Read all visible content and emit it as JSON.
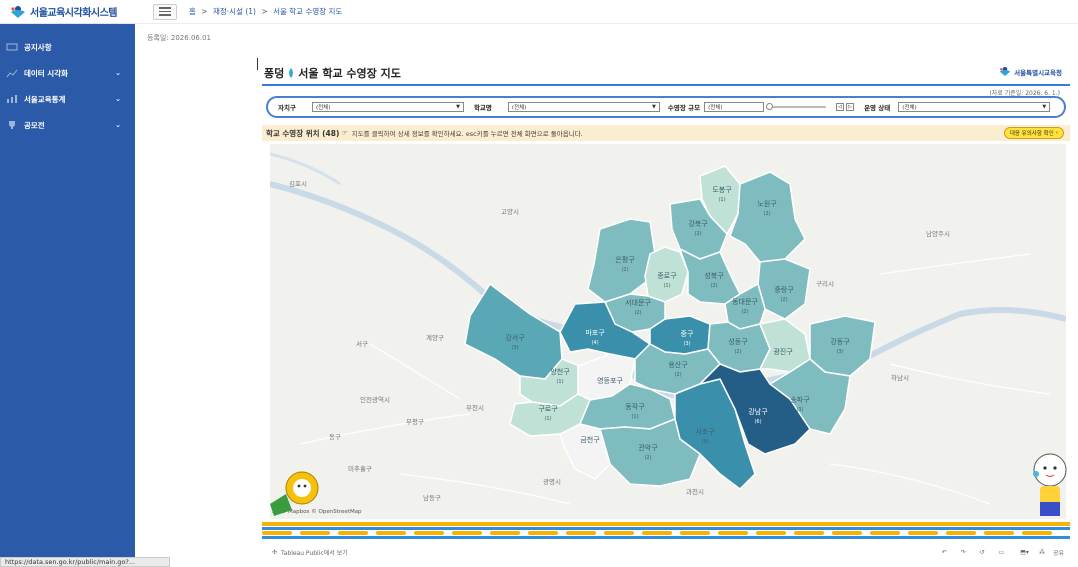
{
  "app": {
    "logo_text": "서울교육시각화시스템"
  },
  "sidebar": {
    "items": [
      {
        "label": "공지사항",
        "icon": "megaphone-icon",
        "has_chevron": false
      },
      {
        "label": "데이터 시각화",
        "icon": "chart-icon",
        "has_chevron": true
      },
      {
        "label": "서울교육통계",
        "icon": "stats-icon",
        "has_chevron": true
      },
      {
        "label": "공모전",
        "icon": "trophy-icon",
        "has_chevron": true
      }
    ],
    "chevron": "⌄"
  },
  "topbar": {
    "breadcrumb": [
      "홈",
      "재정·시설 (1)",
      "서울 학교 수영장 지도"
    ],
    "separator": ">"
  },
  "reg_date": "등록일: 2026.06.01",
  "panel": {
    "title_pre": "퐁덩",
    "title_main": "서울 학교 수영장 지도",
    "edu_logo": "서울특별시교육청",
    "ref_date": "(자료 기준일: 2026. 6. 1.)",
    "filters": {
      "district_label": "자치구",
      "district_value": "(전체)",
      "school_label": "학교명",
      "school_value": "(전체)",
      "size_label": "수영장 규모",
      "size_value": "(전체)",
      "status_label": "운영 상태",
      "status_value": "(전체)"
    },
    "info": {
      "text": "학교 수영장 위치 (48)",
      "hint": "지도를 클릭하여 상세 정보를 확인하세요. esc키를 누르면 전체 화면으로 돌아옵니다.",
      "button": "대응 유의사항 확인"
    },
    "map_labels": {
      "districts": [
        {
          "name": "도봉구",
          "count": "(1)"
        },
        {
          "name": "노원구",
          "count": "(2)"
        },
        {
          "name": "강북구",
          "count": "(2)"
        },
        {
          "name": "은평구",
          "count": "(2)"
        },
        {
          "name": "종로구",
          "count": "(1)"
        },
        {
          "name": "성북구",
          "count": "(2)"
        },
        {
          "name": "중랑구",
          "count": "(2)"
        },
        {
          "name": "서대문구",
          "count": "(2)"
        },
        {
          "name": "동대문구",
          "count": "(2)"
        },
        {
          "name": "강서구",
          "count": "(3)"
        },
        {
          "name": "마포구",
          "count": "(4)"
        },
        {
          "name": "중구",
          "count": "(3)"
        },
        {
          "name": "성동구",
          "count": "(2)"
        },
        {
          "name": "광진구",
          "count": ""
        },
        {
          "name": "강동구",
          "count": "(3)"
        },
        {
          "name": "양천구",
          "count": "(1)"
        },
        {
          "name": "영등포구",
          "count": ""
        },
        {
          "name": "용산구",
          "count": "(2)"
        },
        {
          "name": "구로구",
          "count": "(1)"
        },
        {
          "name": "동작구",
          "count": "(1)"
        },
        {
          "name": "서초구",
          "count": "(3)"
        },
        {
          "name": "강남구",
          "count": "(6)"
        },
        {
          "name": "송파구",
          "count": "(3)"
        },
        {
          "name": "관악구",
          "count": "(2)"
        },
        {
          "name": "금천구",
          "count": ""
        }
      ],
      "places": [
        "김포시",
        "고양시",
        "남양주시",
        "구리시",
        "서구",
        "계양구",
        "인천광역시",
        "부평구",
        "부천시",
        "동구",
        "미추홀구",
        "남동구",
        "광명시",
        "과천시",
        "하남시"
      ]
    },
    "attribution": "© Mapbox © OpenStreetMap",
    "attribution_prefix": "20",
    "footer_link": "Tableau Public에서 보기",
    "footer_share": "공유"
  },
  "status_url": "https://data.sen.go.kr/public/main.go?...",
  "colors": {
    "sidebar": "#2b5ba8",
    "accent": "#3b7ad6",
    "info_bg": "#fbedd0",
    "strong": "#245e86",
    "mid": "#3a8fab",
    "light": "#7fbcbf",
    "pale": "#bfe1d6"
  }
}
